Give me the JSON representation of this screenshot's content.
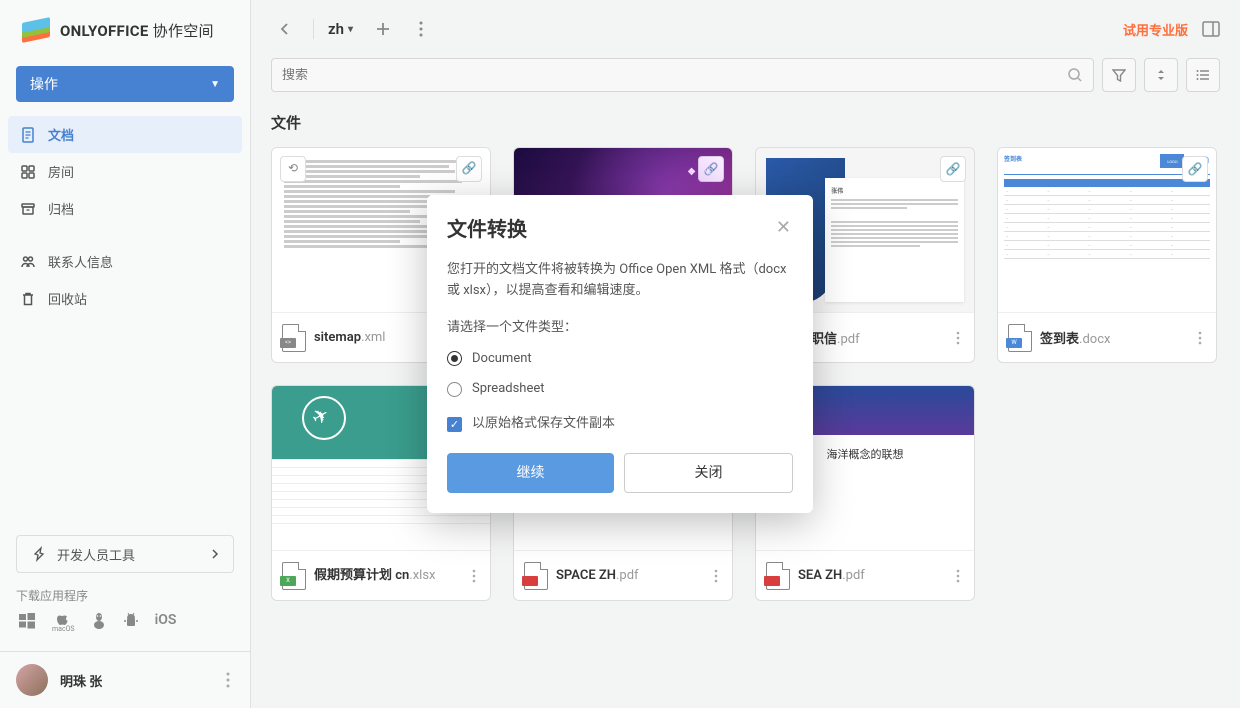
{
  "brand": {
    "name": "ONLYOFFICE",
    "suffix": " 协作空间"
  },
  "sidebar": {
    "action_label": "操作",
    "nav": {
      "documents": "文档",
      "rooms": "房间",
      "archive": "归档",
      "contacts": "联系人信息",
      "trash": "回收站"
    },
    "dev_tools": "开发人员工具",
    "download_label": "下载应用程序",
    "platforms": {
      "ios": "iOS"
    }
  },
  "user": {
    "name": "明珠 张"
  },
  "topbar": {
    "breadcrumb": "zh",
    "trial": "试用专业版"
  },
  "search": {
    "placeholder": "搜索"
  },
  "section": {
    "title": "文件"
  },
  "files": [
    {
      "name": "sitemap",
      "ext": ".xml"
    },
    {
      "name": "",
      "ext": ""
    },
    {
      "name": "辞职信",
      "ext": ".pdf"
    },
    {
      "name": "签到表",
      "ext": ".docx"
    },
    {
      "name": "假期预算计划 cn",
      "ext": ".xlsx"
    },
    {
      "name": "SPACE ZH",
      "ext": ".pdf"
    },
    {
      "name": "SEA ZH",
      "ext": ".pdf"
    }
  ],
  "resign_doc_name": "张伟",
  "signin_title": "签到表",
  "logo_box": "LOGO",
  "sea_title": "海洋概念的联想",
  "modal": {
    "title": "文件转换",
    "desc": "您打开的文档文件将被转换为 Office Open XML 格式（docx 或 xlsx），以提高查看和编辑速度。",
    "label": "请选择一个文件类型：",
    "opt_document": "Document",
    "opt_spreadsheet": "Spreadsheet",
    "keep_copy": "以原始格式保存文件副本",
    "btn_continue": "继续",
    "btn_close": "关闭"
  }
}
